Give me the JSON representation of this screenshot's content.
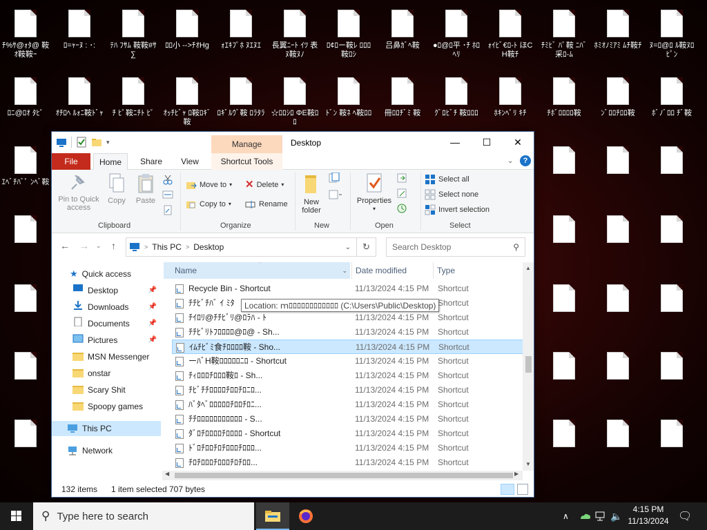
{
  "desktop": {
    "icons": [
      {
        "label": "ﾁ%ｻ@ｫﾀ@ 鞍ｵ鞍鞍ｰ"
      },
      {
        "label": "ﾛ=ｬｰﾇ : ･:"
      },
      {
        "label": "ﾃﾊ ﾌｻﾑ 鞍鞍#ｻ∑"
      },
      {
        "label": "ﾛﾛ小 -->ﾁｵHg"
      },
      {
        "label": "ｫｴｷﾌﾟﾎ ﾇｴﾇｴ"
      },
      {
        "label": "長翼ﾆｰﾄ ｲﾂ 表ﾇ鞍ﾇﾉ"
      },
      {
        "label": "ﾛ¢ﾛー鞍ﾚ ﾛﾛﾛ鞍ﾛｼ"
      },
      {
        "label": "吕鼻ｶﾞﾍ鞍"
      },
      {
        "label": "●ﾛ@ﾛ平 ･ﾁ ﾎﾛﾍﾘ"
      },
      {
        "label": "ｫｲﾋﾞ€ﾛ-ﾄ ほCH鞍ﾁ"
      },
      {
        "label": "ﾁﾐﾋﾞ ﾊﾟ鞍 ﾆﾊﾞ采ﾛ-ﾑ"
      },
      {
        "label": "ﾎﾐｵﾉﾐｱﾐ ﾑﾁ鞍ﾁ"
      },
      {
        "label": "ﾇ=ﾛ@ﾛ ﾙ鞍ﾇﾛﾋﾟﾝ"
      },
      {
        "label": "ﾛﾆ@ﾛｵ ﾀﾋﾟ"
      },
      {
        "label": "ｵﾁﾛﾍ ﾙｫﾆ鞍ﾄﾞｬ"
      },
      {
        "label": "ﾁ ﾋﾟ鞍ﾆﾁﾄ ﾋﾟ"
      },
      {
        "label": "ｵｯﾁﾋﾞｬ ﾛ鞍ﾛｷﾞ鞍"
      },
      {
        "label": "ﾛｷﾞﾙｳﾞ鞍 ﾛﾗﾀﾗ"
      },
      {
        "label": "☆ﾛﾛｼﾛ ΦE鞍ﾛﾛ"
      },
      {
        "label": "ﾄﾞﾝ 鞍ﾈ ﾍ鞍ﾛﾛ"
      },
      {
        "label": "冊ﾛﾛﾁﾞﾐ 鞍"
      },
      {
        "label": "ｸﾞﾛﾋﾞﾁ 鞍ﾛﾛﾛ"
      },
      {
        "label": "ﾎｷﾝﾍﾟﾘ ｷﾁ"
      },
      {
        "label": "ﾁﾎﾞﾛﾛﾛﾛ鞍"
      },
      {
        "label": "ﾝﾞﾛﾛﾁﾛﾛ鞍"
      },
      {
        "label": "ﾎﾞﾉﾞﾛﾛ ﾁﾞ鞍"
      },
      {
        "label": "ｴﾍﾞﾁﾊﾞﾟ ﾝﾍﾞ鞍"
      }
    ]
  },
  "window": {
    "title": "Desktop",
    "manage_tab": "Manage",
    "ribbon_tabs": {
      "file": "File",
      "home": "Home",
      "share": "Share",
      "view": "View",
      "shortcut_tools": "Shortcut Tools"
    },
    "help": "?",
    "clipboard": {
      "pin": "Pin to Quick access",
      "copy": "Copy",
      "paste": "Paste",
      "label": "Clipboard"
    },
    "organize": {
      "move_to": "Move to",
      "copy_to": "Copy to",
      "delete": "Delete",
      "rename": "Rename",
      "label": "Organize"
    },
    "new": {
      "new_folder": "New folder",
      "label": "New"
    },
    "open": {
      "properties": "Properties",
      "label": "Open"
    },
    "select": {
      "select_all": "Select all",
      "select_none": "Select none",
      "invert_selection": "Invert selection",
      "label": "Select"
    },
    "address": {
      "this_pc": "This PC",
      "separator": ">",
      "desktop": "Desktop"
    },
    "search_placeholder": "Search Desktop",
    "nav": {
      "quick_access": "Quick access",
      "items": [
        {
          "label": "Desktop",
          "pinned": true
        },
        {
          "label": "Downloads",
          "pinned": true
        },
        {
          "label": "Documents",
          "pinned": true
        },
        {
          "label": "Pictures",
          "pinned": true
        },
        {
          "label": "MSN Messenger",
          "pinned": false
        },
        {
          "label": "onstar",
          "pinned": false
        },
        {
          "label": "Scary Shit",
          "pinned": false
        },
        {
          "label": "Spoopy games",
          "pinned": false
        }
      ],
      "this_pc": "This PC",
      "network": "Network"
    },
    "columns": {
      "name": "Name",
      "date": "Date modified",
      "type": "Type"
    },
    "files": [
      {
        "name": "Recycle Bin - Shortcut",
        "date": "11/13/2024 4:15 PM",
        "type": "Shortcut"
      },
      {
        "name": "ﾁﾁﾋﾞﾁﾊﾞ ｲ ﾐﾀ",
        "date": "11/13/2024 4:15 PM",
        "type": "Shortcut"
      },
      {
        "name": "ﾁｲﾛﾘ@ﾁﾁﾋﾞﾘ@ﾛﾗﾊ - ﾄ",
        "date": "11/13/2024 4:15 PM",
        "type": "Shortcut"
      },
      {
        "name": "ﾁﾁﾋﾞﾘﾄﾌﾛﾛﾛﾛ@ﾛ@ - Sh...",
        "date": "11/13/2024 4:15 PM",
        "type": "Shortcut"
      },
      {
        "name": "ｲﾑﾁﾋﾞﾐ食ﾁﾛﾛﾛﾛ鞍 - Sho...",
        "date": "11/13/2024 4:15 PM",
        "type": "Shortcut"
      },
      {
        "name": "ーﾊﾞH鞍ﾛﾛﾛﾛﾛﾆﾛ - Shortcut",
        "date": "11/13/2024 4:15 PM",
        "type": "Shortcut"
      },
      {
        "name": "ﾁｨﾛﾛﾛﾁﾛﾛﾛ鞍ﾛ - Sh...",
        "date": "11/13/2024 4:15 PM",
        "type": "Shortcut"
      },
      {
        "name": "ﾁﾋﾞﾁﾁﾛﾛﾛﾛﾁﾛﾛﾁﾛﾆﾛ...",
        "date": "11/13/2024 4:15 PM",
        "type": "Shortcut"
      },
      {
        "name": "ﾊﾞﾀﾍﾞﾛﾛﾛﾛﾛﾁﾛﾛﾁﾛﾆ...",
        "date": "11/13/2024 4:15 PM",
        "type": "Shortcut"
      },
      {
        "name": "ﾁﾁﾛﾛﾛﾛﾛﾛﾛﾛﾛﾛﾛ - S...",
        "date": "11/13/2024 4:15 PM",
        "type": "Shortcut"
      },
      {
        "name": "ﾀﾞﾛﾁﾛﾛﾛﾛﾁﾛﾛﾛﾛ - Shortcut",
        "date": "11/13/2024 4:15 PM",
        "type": "Shortcut"
      },
      {
        "name": "ﾄﾞﾛﾁﾛﾛﾁﾛﾁﾛﾛﾛﾁﾛﾛﾛ...",
        "date": "11/13/2024 4:15 PM",
        "type": "Shortcut"
      },
      {
        "name": "ﾁﾛﾁﾛﾛﾛﾁﾛﾛﾛﾁﾛﾁﾛﾛ...",
        "date": "11/13/2024 4:15 PM",
        "type": "Shortcut"
      }
    ],
    "tooltip": "Location: ｍﾛﾛﾛﾛﾛﾛﾛﾛﾛﾛﾛﾛ (C:\\Users\\Public\\Desktop)",
    "status": {
      "count": "132 items",
      "selected": "1 item selected",
      "size": "707 bytes"
    }
  },
  "taskbar": {
    "search_placeholder": "Type here to search",
    "time": "4:15 PM",
    "date": "11/13/2024"
  }
}
